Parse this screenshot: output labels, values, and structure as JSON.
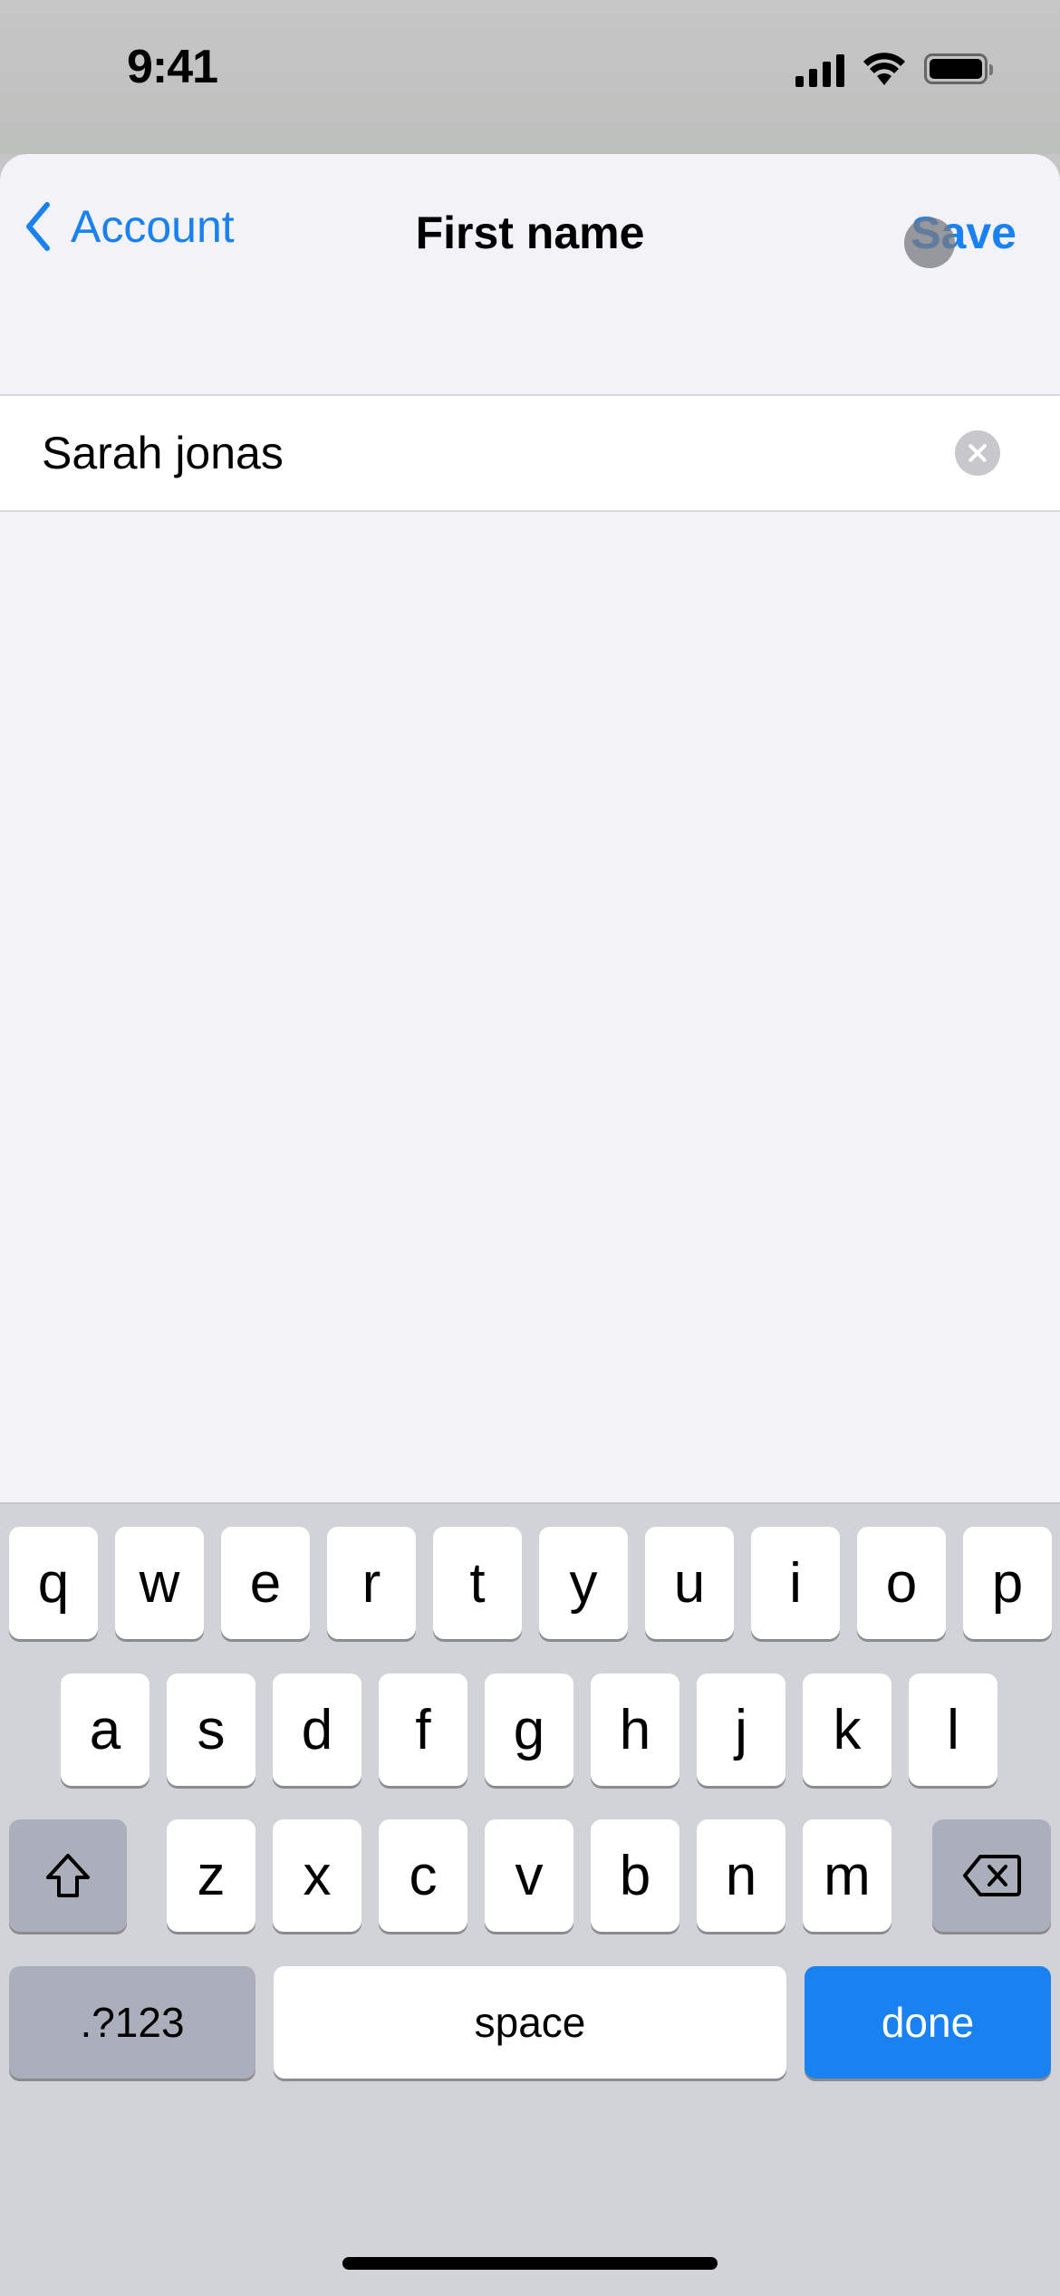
{
  "status_bar": {
    "time": "9:41",
    "icons": [
      "cellular-signal-icon",
      "wifi-icon",
      "battery-icon"
    ]
  },
  "nav": {
    "back_label": "Account",
    "back_icon": "chevron-left-icon",
    "title": "First name",
    "save_label": "Save"
  },
  "field": {
    "value": "Sarah jonas",
    "clear_icon": "clear-x-icon"
  },
  "keyboard": {
    "row1": [
      "q",
      "w",
      "e",
      "r",
      "t",
      "y",
      "u",
      "i",
      "o",
      "p"
    ],
    "row2": [
      "a",
      "s",
      "d",
      "f",
      "g",
      "h",
      "j",
      "k",
      "l"
    ],
    "row3": [
      "z",
      "x",
      "c",
      "v",
      "b",
      "n",
      "m"
    ],
    "shift_icon": "shift-arrow-icon",
    "delete_icon": "backspace-icon",
    "numbers_label": ".?123",
    "space_label": "space",
    "done_label": "done"
  },
  "colors": {
    "accent": "#1a82f0",
    "sheet_bg": "#f2f2f7",
    "keyboard_bg": "#d1d3d9"
  }
}
